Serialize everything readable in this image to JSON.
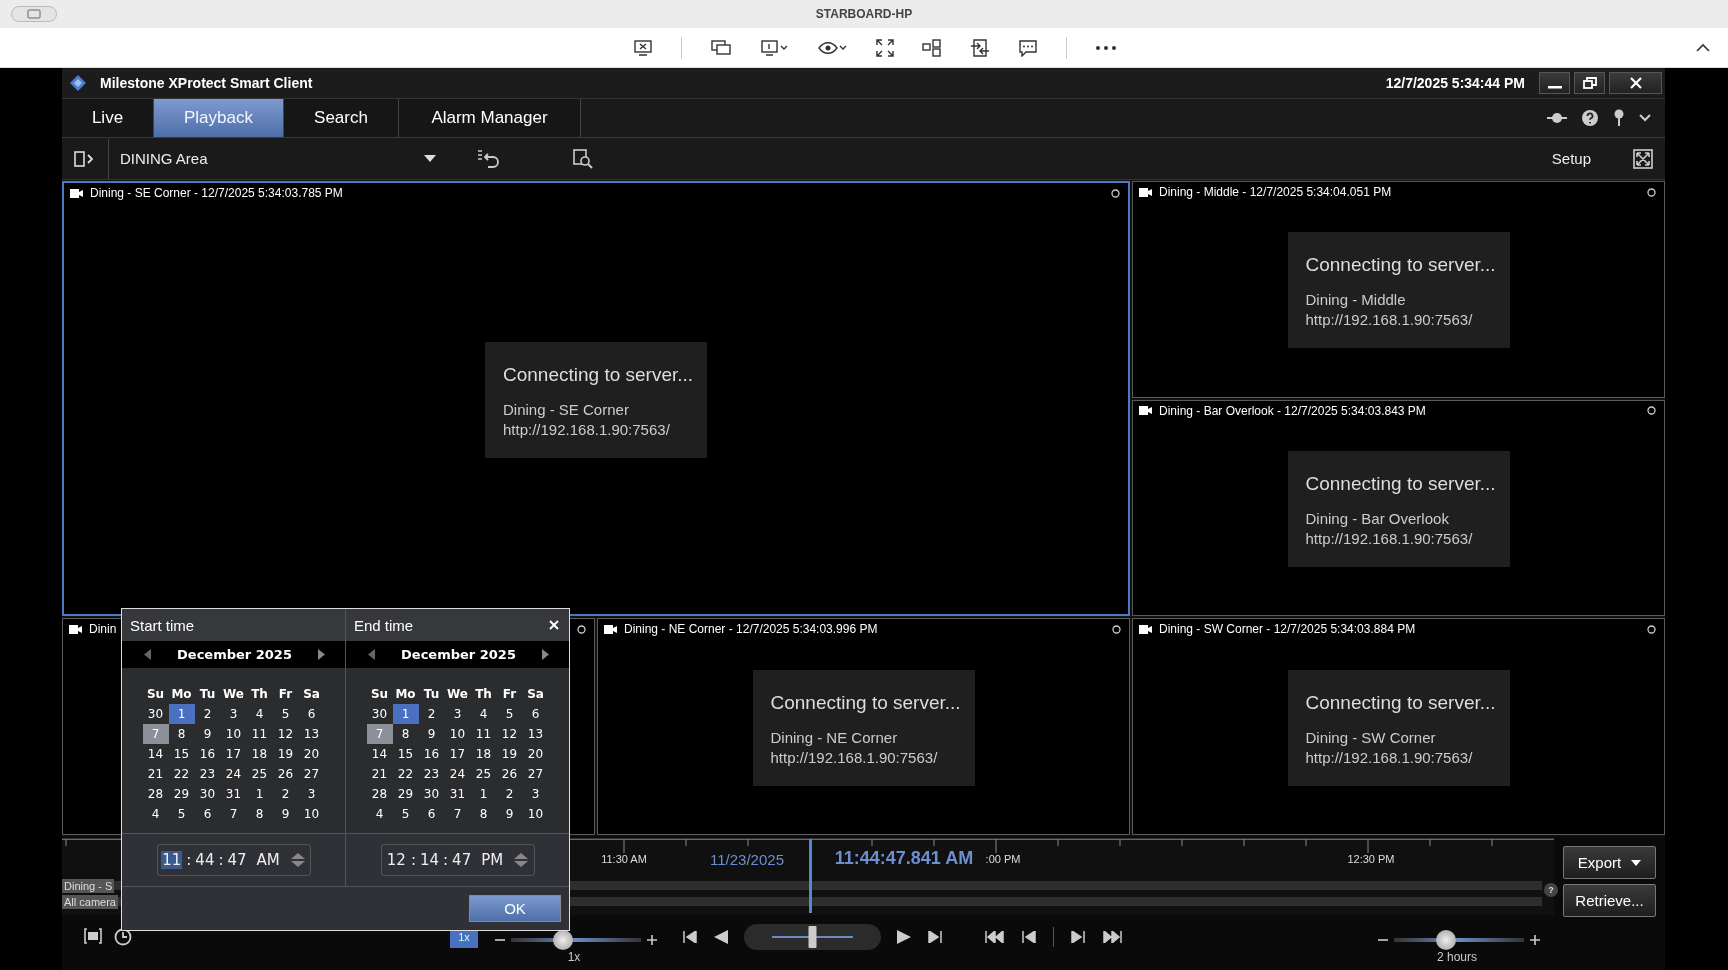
{
  "remote_window": {
    "title": "STARBOARD-HP"
  },
  "app": {
    "title": "Milestone XProtect Smart Client",
    "clock": "12/7/2025 5:34:44 PM"
  },
  "tabs": [
    {
      "label": "Live",
      "selected": false
    },
    {
      "label": "Playback",
      "selected": true
    },
    {
      "label": "Search",
      "selected": false
    },
    {
      "label": "Alarm Manager",
      "selected": false
    }
  ],
  "toolbar": {
    "view": "DINING Area",
    "setup": "Setup"
  },
  "cameras": [
    {
      "header": "Dining - SE Corner - 12/7/2025 5:34:03.785 PM",
      "selected": true,
      "status": "Connecting to server...",
      "name": "Dining - SE Corner",
      "url": "http://192.168.1.90:7563/"
    },
    {
      "header": "Dining - Middle - 12/7/2025 5:34:04.051 PM",
      "selected": false,
      "status": "Connecting to server...",
      "name": "Dining - Middle",
      "url": "http://192.168.1.90:7563/"
    },
    {
      "header": "Dining - Bar Overlook - 12/7/2025 5:34:03.843 PM",
      "selected": false,
      "status": "Connecting to server...",
      "name": "Dining - Bar Overlook",
      "url": "http://192.168.1.90:7563/"
    },
    {
      "header": "Dinin",
      "selected": false
    },
    {
      "header": "Dining - NE Corner - 12/7/2025 5:34:03.996 PM",
      "selected": false,
      "status": "Connecting to server...",
      "name": "Dining - NE Corner",
      "url": "http://192.168.1.90:7563/"
    },
    {
      "header": "Dining - SW Corner - 12/7/2025 5:34:03.884 PM",
      "selected": false,
      "status": "Connecting to server...",
      "name": "Dining - SW Corner",
      "url": "http://192.168.1.90:7563/"
    }
  ],
  "date_picker": {
    "ok": "OK",
    "panels": [
      {
        "title": "Start time",
        "month": "December 2025",
        "weekdays": [
          "Su",
          "Mo",
          "Tu",
          "We",
          "Th",
          "Fr",
          "Sa"
        ],
        "days": [
          {
            "label": "30",
            "selected": false,
            "today": false
          },
          {
            "label": "1",
            "selected": true,
            "today": false
          },
          {
            "label": "2",
            "selected": false,
            "today": false
          },
          {
            "label": "3",
            "selected": false,
            "today": false
          },
          {
            "label": "4",
            "selected": false,
            "today": false
          },
          {
            "label": "5",
            "selected": false,
            "today": false
          },
          {
            "label": "6",
            "selected": false,
            "today": false
          },
          {
            "label": "7",
            "selected": false,
            "today": true
          },
          {
            "label": "8",
            "selected": false,
            "today": false
          },
          {
            "label": "9",
            "selected": false,
            "today": false
          },
          {
            "label": "10",
            "selected": false,
            "today": false
          },
          {
            "label": "11",
            "selected": false,
            "today": false
          },
          {
            "label": "12",
            "selected": false,
            "today": false
          },
          {
            "label": "13",
            "selected": false,
            "today": false
          },
          {
            "label": "14",
            "selected": false,
            "today": false
          },
          {
            "label": "15",
            "selected": false,
            "today": false
          },
          {
            "label": "16",
            "selected": false,
            "today": false
          },
          {
            "label": "17",
            "selected": false,
            "today": false
          },
          {
            "label": "18",
            "selected": false,
            "today": false
          },
          {
            "label": "19",
            "selected": false,
            "today": false
          },
          {
            "label": "20",
            "selected": false,
            "today": false
          },
          {
            "label": "21",
            "selected": false,
            "today": false
          },
          {
            "label": "22",
            "selected": false,
            "today": false
          },
          {
            "label": "23",
            "selected": false,
            "today": false
          },
          {
            "label": "24",
            "selected": false,
            "today": false
          },
          {
            "label": "25",
            "selected": false,
            "today": false
          },
          {
            "label": "26",
            "selected": false,
            "today": false
          },
          {
            "label": "27",
            "selected": false,
            "today": false
          },
          {
            "label": "28",
            "selected": false,
            "today": false
          },
          {
            "label": "29",
            "selected": false,
            "today": false
          },
          {
            "label": "30",
            "selected": false,
            "today": false
          },
          {
            "label": "31",
            "selected": false,
            "today": false
          },
          {
            "label": "1",
            "selected": false,
            "today": false
          },
          {
            "label": "2",
            "selected": false,
            "today": false
          },
          {
            "label": "3",
            "selected": false,
            "today": false
          },
          {
            "label": "4",
            "selected": false,
            "today": false
          },
          {
            "label": "5",
            "selected": false,
            "today": false
          },
          {
            "label": "6",
            "selected": false,
            "today": false
          },
          {
            "label": "7",
            "selected": false,
            "today": false
          },
          {
            "label": "8",
            "selected": false,
            "today": false
          },
          {
            "label": "9",
            "selected": false,
            "today": false
          },
          {
            "label": "10",
            "selected": false,
            "today": false
          }
        ],
        "time": {
          "hour": "11",
          "separator": ":",
          "minute": "44",
          "second": "47",
          "period": "AM",
          "hour_selected": true
        }
      },
      {
        "title": "End time",
        "month": "December 2025",
        "weekdays": [
          "Su",
          "Mo",
          "Tu",
          "We",
          "Th",
          "Fr",
          "Sa"
        ],
        "days": [
          {
            "label": "30",
            "selected": false,
            "today": false
          },
          {
            "label": "1",
            "selected": true,
            "today": false
          },
          {
            "label": "2",
            "selected": false,
            "today": false
          },
          {
            "label": "3",
            "selected": false,
            "today": false
          },
          {
            "label": "4",
            "selected": false,
            "today": false
          },
          {
            "label": "5",
            "selected": false,
            "today": false
          },
          {
            "label": "6",
            "selected": false,
            "today": false
          },
          {
            "label": "7",
            "selected": false,
            "today": true
          },
          {
            "label": "8",
            "selected": false,
            "today": false
          },
          {
            "label": "9",
            "selected": false,
            "today": false
          },
          {
            "label": "10",
            "selected": false,
            "today": false
          },
          {
            "label": "11",
            "selected": false,
            "today": false
          },
          {
            "label": "12",
            "selected": false,
            "today": false
          },
          {
            "label": "13",
            "selected": false,
            "today": false
          },
          {
            "label": "14",
            "selected": false,
            "today": false
          },
          {
            "label": "15",
            "selected": false,
            "today": false
          },
          {
            "label": "16",
            "selected": false,
            "today": false
          },
          {
            "label": "17",
            "selected": false,
            "today": false
          },
          {
            "label": "18",
            "selected": false,
            "today": false
          },
          {
            "label": "19",
            "selected": false,
            "today": false
          },
          {
            "label": "20",
            "selected": false,
            "today": false
          },
          {
            "label": "21",
            "selected": false,
            "today": false
          },
          {
            "label": "22",
            "selected": false,
            "today": false
          },
          {
            "label": "23",
            "selected": false,
            "today": false
          },
          {
            "label": "24",
            "selected": false,
            "today": false
          },
          {
            "label": "25",
            "selected": false,
            "today": false
          },
          {
            "label": "26",
            "selected": false,
            "today": false
          },
          {
            "label": "27",
            "selected": false,
            "today": false
          },
          {
            "label": "28",
            "selected": false,
            "today": false
          },
          {
            "label": "29",
            "selected": false,
            "today": false
          },
          {
            "label": "30",
            "selected": false,
            "today": false
          },
          {
            "label": "31",
            "selected": false,
            "today": false
          },
          {
            "label": "1",
            "selected": false,
            "today": false
          },
          {
            "label": "2",
            "selected": false,
            "today": false
          },
          {
            "label": "3",
            "selected": false,
            "today": false
          },
          {
            "label": "4",
            "selected": false,
            "today": false
          },
          {
            "label": "5",
            "selected": false,
            "today": false
          },
          {
            "label": "6",
            "selected": false,
            "today": false
          },
          {
            "label": "7",
            "selected": false,
            "today": false
          },
          {
            "label": "8",
            "selected": false,
            "today": false
          },
          {
            "label": "9",
            "selected": false,
            "today": false
          },
          {
            "label": "10",
            "selected": false,
            "today": false
          }
        ],
        "time": {
          "hour": "12",
          "separator": ":",
          "minute": "14",
          "second": "47",
          "period": "PM",
          "hour_selected": false
        }
      }
    ]
  },
  "timeline": {
    "tracks": [
      "Dining - S",
      "All camera"
    ],
    "date": "11/23/2025",
    "current": "11:44:47.841 AM",
    "ticks": [
      {
        "label": "11:30 AM"
      },
      {
        "label": ":00 PM"
      },
      {
        "label": "12:30 PM"
      }
    ],
    "help": "?"
  },
  "speed": {
    "button": "1x",
    "label": "1x",
    "level": 0.4
  },
  "jog": {
    "level": 0.5
  },
  "range": {
    "label": "2 hours",
    "level": 0.4
  },
  "export": "Export",
  "retrieve": "Retrieve..."
}
